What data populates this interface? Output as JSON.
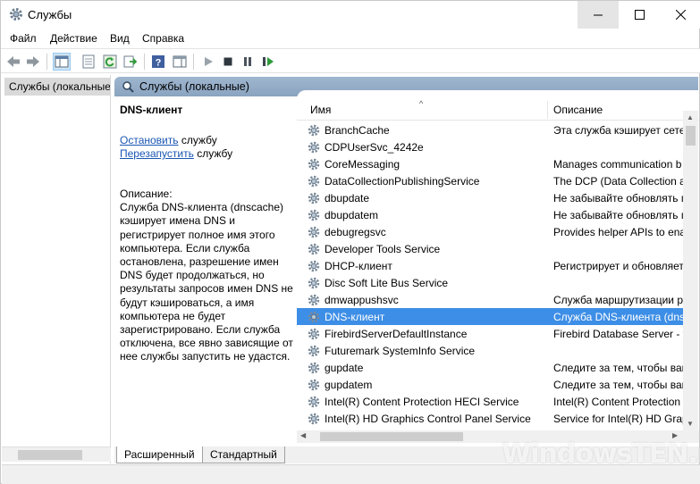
{
  "window": {
    "title": "Службы"
  },
  "menu": [
    {
      "label": "Файл",
      "key": "Ф"
    },
    {
      "label": "Действие",
      "key": "Д"
    },
    {
      "label": "Вид",
      "key": "В"
    },
    {
      "label": "Справка",
      "key": "С"
    }
  ],
  "tree": {
    "item": "Службы (локальные)"
  },
  "pane": {
    "header": "Службы (локальные)"
  },
  "details": {
    "title": "DNS-клиент",
    "stop_link": "Остановить",
    "stop_suffix": " службу",
    "restart_link": "Перезапустить",
    "restart_suffix": " службу",
    "desc_label": "Описание:",
    "desc_lines": [
      "Служба DNS-клиента (dnscache)",
      "кэширует имена DNS и",
      "регистрирует полное имя этого",
      "компьютера. Если служба",
      "остановлена, разрешение имен",
      "DNS будет продолжаться, но",
      "результаты запросов имен DNS не",
      "будут кэшироваться, а имя",
      "компьютера не будет",
      "зарегистрировано. Если служба",
      "отключена, все явно зависящие от",
      "нее службы запустить не удастся."
    ]
  },
  "columns": {
    "name": "Имя",
    "description": "Описание"
  },
  "services": [
    {
      "name": "BranchCache",
      "desc": "Эта служба кэширует сете"
    },
    {
      "name": "CDPUserSvc_4242e",
      "desc": ""
    },
    {
      "name": "CoreMessaging",
      "desc": "Manages communication b"
    },
    {
      "name": "DataCollectionPublishingService",
      "desc": "The DCP (Data Collection a"
    },
    {
      "name": "dbupdate",
      "desc": "Не забывайте обновлять п"
    },
    {
      "name": "dbupdatem",
      "desc": "Не забывайте обновлять п"
    },
    {
      "name": "debugregsvc",
      "desc": "Provides helper APIs to enal"
    },
    {
      "name": "Developer Tools Service",
      "desc": ""
    },
    {
      "name": "DHCP-клиент",
      "desc": "Регистрирует и обновляет"
    },
    {
      "name": "Disc Soft Lite Bus Service",
      "desc": ""
    },
    {
      "name": "dmwappushsvc",
      "desc": "Служба маршрутизации р"
    },
    {
      "name": "DNS-клиент",
      "desc": "Служба DNS-клиента (dns",
      "selected": true
    },
    {
      "name": "FirebirdServerDefaultInstance",
      "desc": "Firebird Database Server - w"
    },
    {
      "name": "Futuremark SystemInfo Service",
      "desc": ""
    },
    {
      "name": "gupdate",
      "desc": "Следите за тем, чтобы ваш"
    },
    {
      "name": "gupdatem",
      "desc": "Следите за тем, чтобы ваш"
    },
    {
      "name": "Intel(R) Content Protection HECI Service",
      "desc": "Intel(R) Content Protection"
    },
    {
      "name": "Intel(R) HD Graphics Control Panel Service",
      "desc": "Service for Intel(R) HD Grap"
    }
  ],
  "tabs": {
    "extended": "Расширенный",
    "standard": "Стандартный"
  },
  "watermark": "WindowsTEN.ru"
}
